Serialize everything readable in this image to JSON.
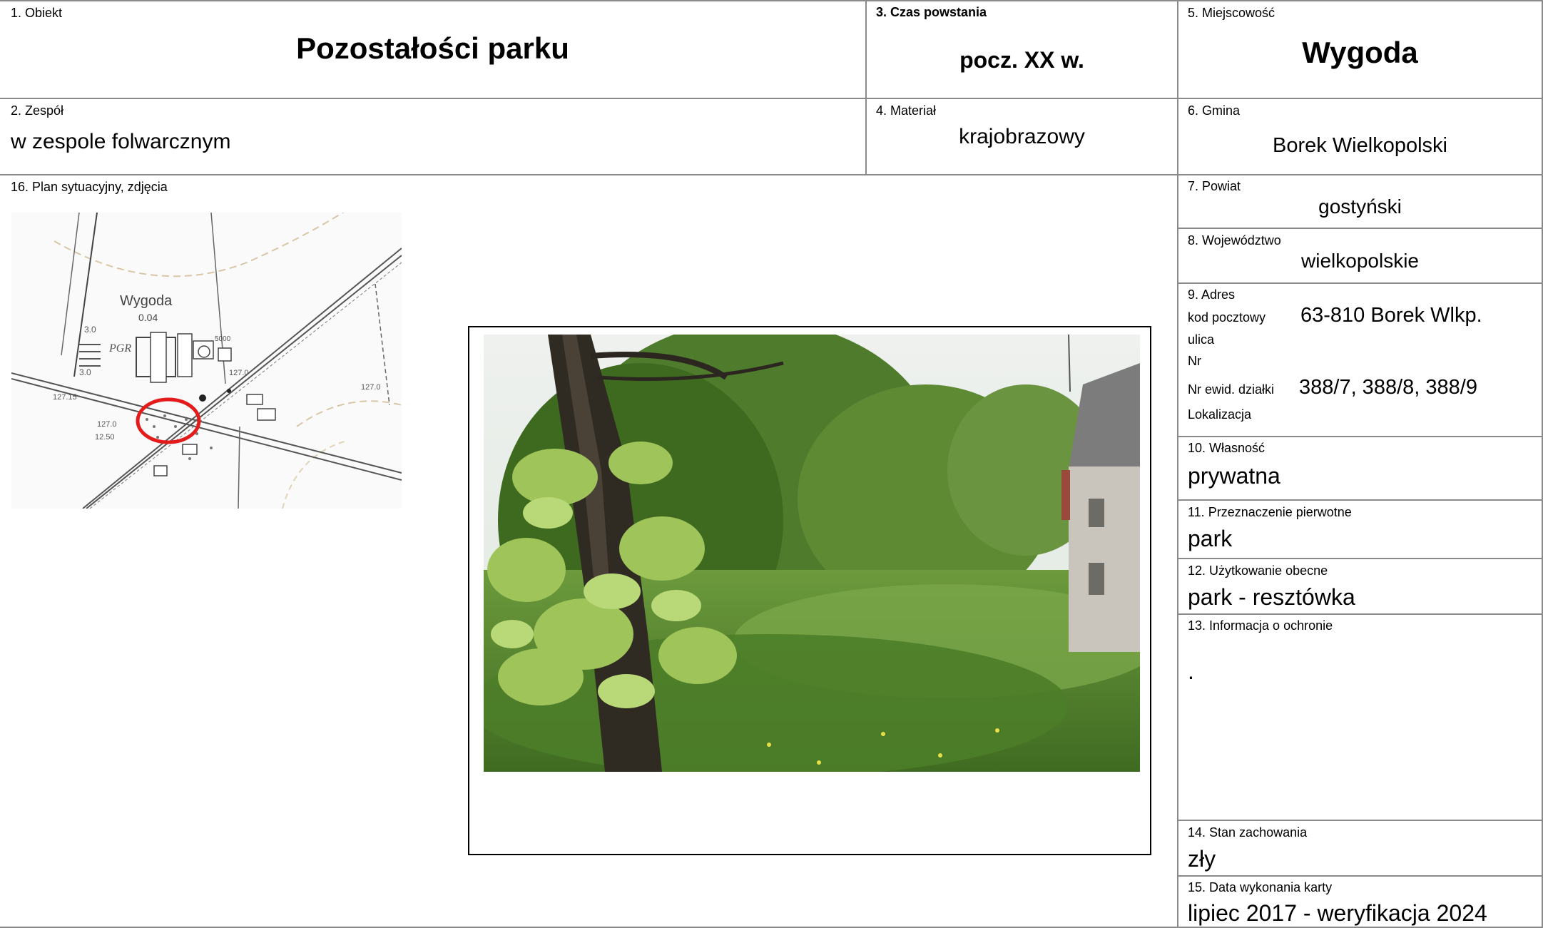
{
  "obiekt": {
    "label": "1. Obiekt",
    "value": "Pozostałości parku"
  },
  "zespol": {
    "label": "2. Zespół",
    "value": "w zespole folwarcznym"
  },
  "czas": {
    "label": "3. Czas powstania",
    "value": "pocz. XX w."
  },
  "material": {
    "label": "4. Materiał",
    "value": "krajobrazowy"
  },
  "miejscowosc": {
    "label": "5. Miejscowość",
    "value": "Wygoda"
  },
  "gmina": {
    "label": "6. Gmina",
    "value": "Borek Wielkopolski"
  },
  "powiat": {
    "label": "7. Powiat",
    "value": "gostyński"
  },
  "wojewodztwo": {
    "label": "8. Województwo",
    "value": "wielkopolskie"
  },
  "adres": {
    "label": "9. Adres",
    "kod_label": "kod pocztowy",
    "kod_value": "63-810 Borek Wlkp.",
    "ulica_label": "ulica",
    "nr_label": "Nr",
    "dzialki_label": "Nr ewid. działki",
    "dzialki_value": "388/7, 388/8, 388/9",
    "lokalizacja_label": "Lokalizacja"
  },
  "wlasnosc": {
    "label": "10. Własność",
    "value": "prywatna"
  },
  "przeznaczenie": {
    "label": "11. Przeznaczenie pierwotne",
    "value": "park"
  },
  "uzytkowanie": {
    "label": "12. Użytkowanie obecne",
    "value": "park - resztówka"
  },
  "ochrona": {
    "label": "13. Informacja o ochronie",
    "value": "."
  },
  "stan": {
    "label": "14. Stan zachowania",
    "value": "zły"
  },
  "data_karty": {
    "label": "15. Data wykonania karty",
    "value": "lipiec 2017 - weryfikacja 2024"
  },
  "plan": {
    "label": "16. Plan sytuacyjny, zdjęcia"
  },
  "map": {
    "place": "Wygoda",
    "elev_label": "0.04",
    "pgr": "PGR",
    "n1": "3.0",
    "n2": "3.0",
    "n3": "127.15",
    "n4": "127.0",
    "n5": "12.50",
    "n6": "127.0",
    "n7": "127.0",
    "n8": "5000",
    "highlight_color": "#e31b1b"
  }
}
